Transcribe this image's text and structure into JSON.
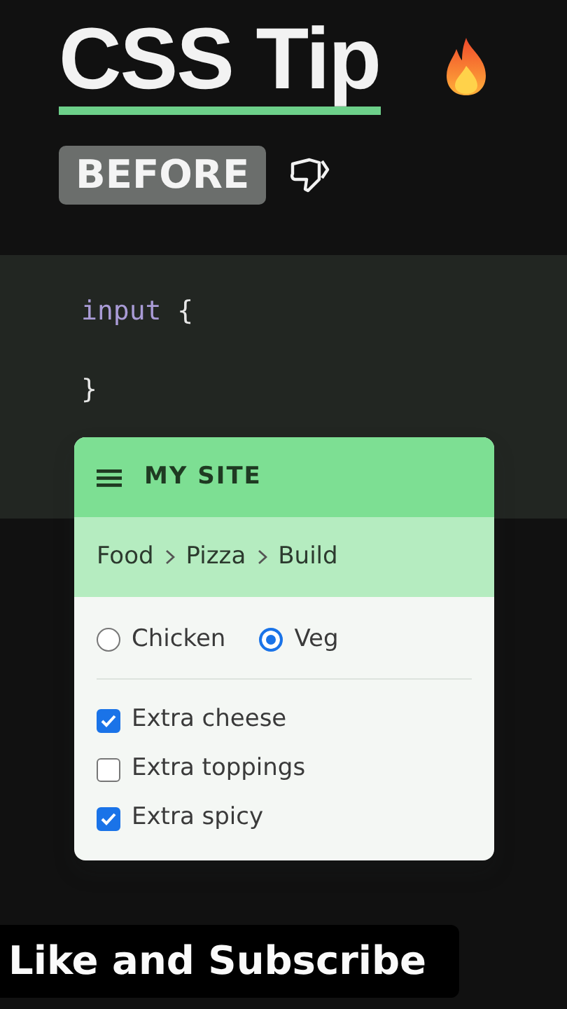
{
  "title": "CSS Tip",
  "badge": "BEFORE",
  "code_lines": [
    {
      "kind": "selector",
      "text": "input",
      "brace": "{"
    },
    {
      "kind": "blank"
    },
    {
      "kind": "close",
      "brace": "}"
    }
  ],
  "card": {
    "brand": "MY SITE",
    "breadcrumb": [
      "Food",
      "Pizza",
      "Build"
    ],
    "radios": [
      {
        "label": "Chicken",
        "selected": false
      },
      {
        "label": "Veg",
        "selected": true
      }
    ],
    "checkboxes": [
      {
        "label": "Extra cheese",
        "checked": true
      },
      {
        "label": "Extra toppings",
        "checked": false
      },
      {
        "label": "Extra spicy",
        "checked": true
      }
    ]
  },
  "caption": "Like and Subscribe"
}
